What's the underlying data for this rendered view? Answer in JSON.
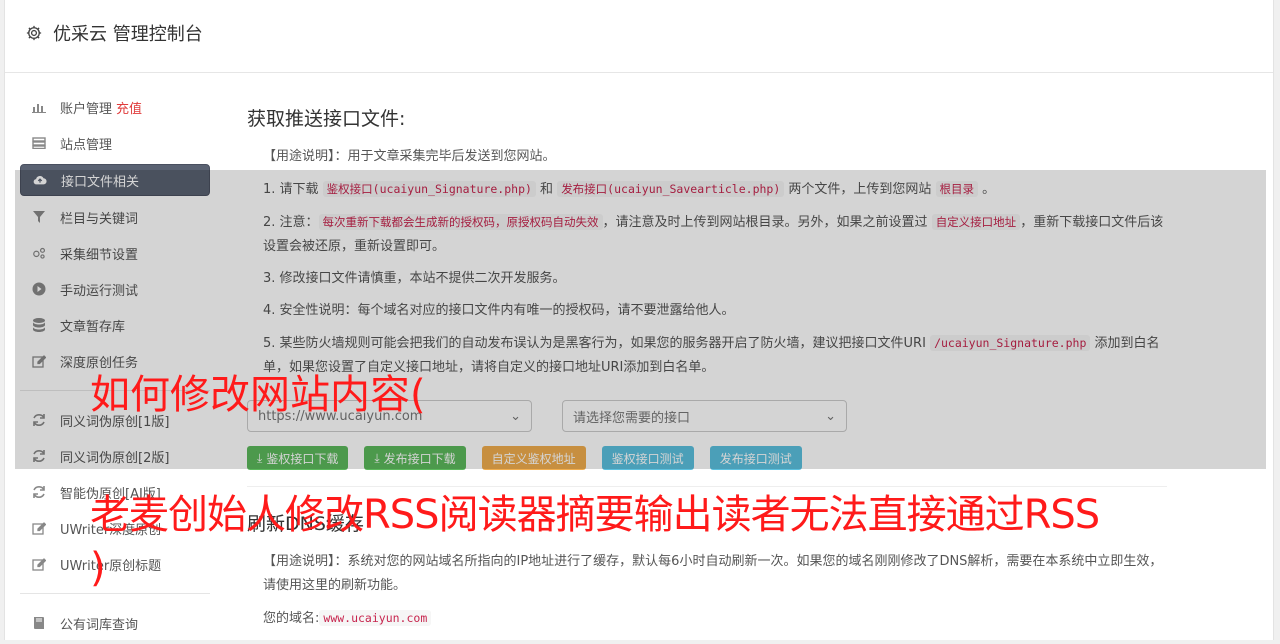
{
  "header": {
    "title": "优采云 管理控制台",
    "icon": "gear-icon"
  },
  "sidebar": {
    "items": [
      {
        "label": "账户管理",
        "extra": "充值",
        "icon": "bar-chart-icon"
      },
      {
        "label": "站点管理",
        "icon": "server-icon"
      },
      {
        "label": "接口文件相关",
        "icon": "cloud-upload-icon",
        "active": true
      },
      {
        "label": "栏目与关键词",
        "icon": "filter-icon"
      },
      {
        "label": "采集细节设置",
        "icon": "gears-icon"
      },
      {
        "label": "手动运行测试",
        "icon": "play-icon"
      },
      {
        "label": "文章暂存库",
        "icon": "database-icon"
      },
      {
        "label": "深度原创任务",
        "icon": "edit-icon"
      }
    ],
    "items2": [
      {
        "label": "同义词伪原创[1版]",
        "icon": "refresh-icon"
      },
      {
        "label": "同义词伪原创[2版]",
        "icon": "refresh-icon"
      },
      {
        "label": "智能伪原创[AI版]",
        "icon": "refresh-icon"
      },
      {
        "label": "UWriter深度原创",
        "icon": "edit-icon"
      },
      {
        "label": "UWriter原创标题",
        "icon": "edit-icon"
      }
    ],
    "items3": [
      {
        "label": "公有词库查询",
        "icon": "book-icon"
      }
    ]
  },
  "main": {
    "heading": "获取推送接口文件:",
    "usage": "【用途说明】：用于文章采集完毕后发送到您网站。",
    "p1_a": "1. 请下载 ",
    "p1_code1": "鉴权接口(ucaiyun_Signature.php)",
    "p1_b": " 和 ",
    "p1_code2": "发布接口(ucaiyun_Savearticle.php)",
    "p1_c": " 两个文件，上传到您网站 ",
    "p1_code3": "根目录",
    "p1_d": " 。",
    "p2_a": "2. 注意：",
    "p2_code1": "每次重新下载都会生成新的授权码，原授权码自动失效",
    "p2_b": "，请注意及时上传到网站根目录。另外，如果之前设置过 ",
    "p2_code2": "自定义接口地址",
    "p2_c": "，重新下载接口文件后该设置会被还原，重新设置即可。",
    "p3": "3. 修改接口文件请慎重，本站不提供二次开发服务。",
    "p4": "4. 安全性说明：每个域名对应的接口文件内有唯一的授权码，请不要泄露给他人。",
    "p5_a": "5. 某些防火墙规则可能会把我们的自动发布误认为是黑客行为，如果您的服务器开启了防火墙，建议把接口文件URI ",
    "p5_code": "/ucaiyun_Signature.php",
    "p5_b": " 添加到白名单，如果您设置了自定义接口地址，请将自定义的接口地址URI添加到白名单。",
    "select_site": "https://www.ucaiyun.com",
    "select_api": "请选择您需要的接口",
    "buttons": [
      "鉴权接口下载",
      "发布接口下载",
      "自定义鉴权地址",
      "鉴权接口测试",
      "发布接口测试"
    ]
  },
  "section2": {
    "heading": "刷新DNS缓存",
    "usage": "【用途说明】：系统对您的网站域名所指向的IP地址进行了缓存，默认每6小时自动刷新一次。如果您的域名刚刚修改了DNS解析，需要在本系统中立即生效，请使用这里的刷新功能。",
    "domain_label": "您的域名:",
    "domain_value": "www.ucaiyun.com"
  },
  "overlay_text": {
    "line1": "如何修改网站内容(",
    "line2": "老麦创始人修改RSS阅读器摘要输出读者无法直接通过RSS",
    "line3": ")"
  }
}
